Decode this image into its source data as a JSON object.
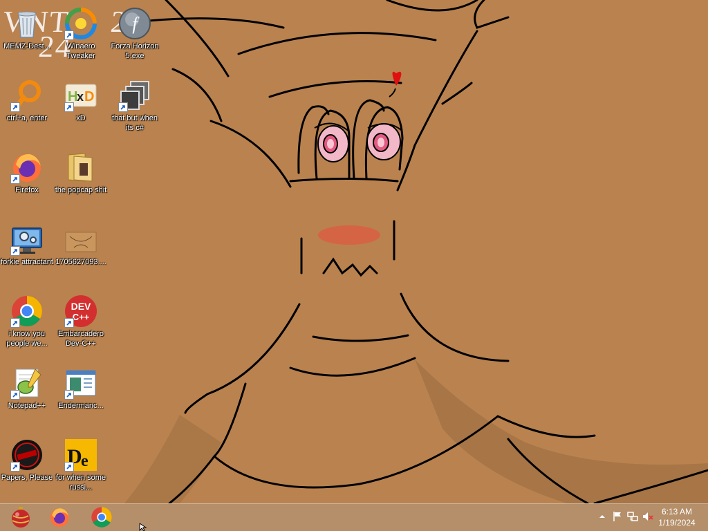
{
  "desktop": {
    "watermark": {
      "line1": "VNT",
      "line2": "2",
      "line3": "24"
    },
    "icons": [
      {
        "label": "MEMZ-Dest...",
        "icon": "recycle-bin-icon",
        "shortcut": false
      },
      {
        "label": "Winaero Tweaker",
        "icon": "winaero-tweaker-icon",
        "shortcut": true
      },
      {
        "label": "Forza Horizon 5.exe",
        "icon": "flash-player-icon",
        "shortcut": false
      },
      {
        "label": "ctrl+a, enter",
        "icon": "orange-magnifier-icon",
        "shortcut": true
      },
      {
        "label": "xD",
        "icon": "hxd-icon",
        "shortcut": true
      },
      {
        "label": "that but when its c#",
        "icon": "stacked-windows-icon",
        "shortcut": true
      },
      {
        "label": "Firefox",
        "icon": "firefox-icon",
        "shortcut": true
      },
      {
        "label": "the popcap shit",
        "icon": "folder-icon",
        "shortcut": false
      },
      {
        "label": "forkie attractant",
        "icon": "computer-settings-icon",
        "shortcut": true
      },
      {
        "label": "1705627093....",
        "icon": "image-file-icon",
        "shortcut": false
      },
      {
        "label": "i know you people we...",
        "icon": "chrome-icon",
        "shortcut": true
      },
      {
        "label": "Embarcadero Dev-C++",
        "icon": "dev-cpp-icon",
        "shortcut": true
      },
      {
        "label": "Notepad++",
        "icon": "notepad-plus-plus-icon",
        "shortcut": true
      },
      {
        "label": "Endermanc...",
        "icon": "window-app-icon",
        "shortcut": true
      },
      {
        "label": "Papers, Please",
        "icon": "papers-please-icon",
        "shortcut": true
      },
      {
        "label": "for when some russi...",
        "icon": "de-app-icon",
        "shortcut": true
      }
    ]
  },
  "taskbar": {
    "pinned": [
      {
        "name": "start-orb",
        "icon": "christmas-ornament-icon"
      },
      {
        "name": "firefox",
        "icon": "firefox-icon"
      },
      {
        "name": "chrome",
        "icon": "chrome-icon"
      }
    ],
    "tray": {
      "icons": [
        "show-hidden-icons-icon",
        "action-center-flag-icon",
        "network-icon",
        "volume-muted-icon"
      ],
      "time": "6:13 AM",
      "date": "1/19/2024"
    }
  },
  "colors": {
    "wallpaper_bg": "#b9824f",
    "taskbar_bg": "#b48f6a",
    "label_text": "#ffffff"
  }
}
